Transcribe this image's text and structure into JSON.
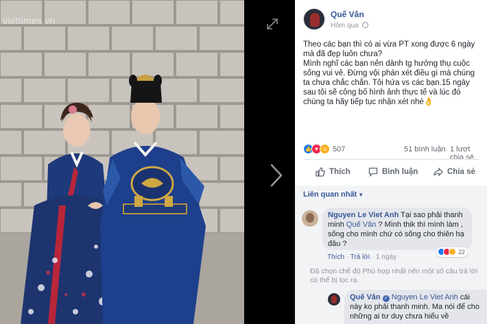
{
  "viewer": {
    "watermark": "viettimes.vn",
    "expand_icon": "expand-icon",
    "next_icon": "chevron-right-icon"
  },
  "post": {
    "author": "Quế Vân",
    "time": "Hôm qua",
    "privacy_icon": "globe-icon",
    "text_line1": "Theo các bạn thì có ai vừa PT xong được 6 ngày mà đã đẹp luôn chưa?",
    "text_line2": "Mình nghĩ các bạn nên dành tg hưởng thụ cuộc sống vui vẻ. Đừng vội phán xét điều gì mà chúng ta chưa chắc chắn. Tôi hứa vs các bạn.15 ngày sau tôi sẽ công bố hình ảnh thực tế và lúc đó chúng ta hãy tiếp tục nhận xét nhé👌",
    "reaction_count": "507",
    "comment_count": "51 bình luận",
    "share_count": "1 lượt chia sẻ",
    "like_label": "Thích",
    "comment_label": "Bình luận",
    "share_label": "Chia sẻ"
  },
  "comments": {
    "sort_label": "Liên quan nhất",
    "first": {
      "name": "Nguyen Le Viet Anh",
      "text_before": "Tại sao phải thanh minh",
      "mention": "Quế Vân",
      "text_after": "? Mình thik thì mình làm , sống cho mình chứ có sống cho thiên hạ đâu ?",
      "reactions": "22",
      "like_link": "Thích",
      "reply_link": "Trả lời",
      "time": "1 ngày"
    },
    "notice": "Đã chọn chế độ Phù hợp nhất nên một số câu trả lời có thể bị lọc ra.",
    "reply": {
      "name": "Quế Vân",
      "mention": "Nguyen Le Viet Anh",
      "text": "cái này ko phải thanh minh. Ma nói để cho những ai tư duy chưa hiểu về"
    }
  },
  "colors": {
    "link_blue": "#385898",
    "like_blue": "#2078f4",
    "love_red": "#f0284a",
    "haha_yellow": "#f7b125",
    "meta_gray": "#90949c",
    "bubble_gray": "#e4e6eb"
  }
}
